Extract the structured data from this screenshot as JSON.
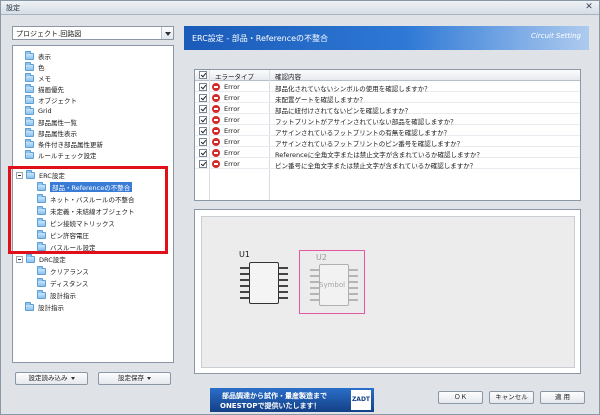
{
  "window": {
    "title": "設定",
    "close_glyph": "✕"
  },
  "project_combo": {
    "value": "プロジェクト.回路図"
  },
  "tree": {
    "items": [
      {
        "label": "表示",
        "level": 1
      },
      {
        "label": "色",
        "level": 1
      },
      {
        "label": "メモ",
        "level": 1
      },
      {
        "label": "描画優先",
        "level": 1
      },
      {
        "label": "オブジェクト",
        "level": 1
      },
      {
        "label": "Grid",
        "level": 1
      },
      {
        "label": "部品属性一覧",
        "level": 1
      },
      {
        "label": "部品属性表示",
        "level": 1
      },
      {
        "label": "条件付き部品属性更新",
        "level": 1
      },
      {
        "label": "ルールチェック設定",
        "level": 1
      },
      {
        "label": "ERC設定",
        "level": 0
      },
      {
        "label": "部品・Referenceの不整合",
        "level": 2,
        "selected": true
      },
      {
        "label": "ネット・バスルールの不整合",
        "level": 2
      },
      {
        "label": "未定義・未結線オブジェクト",
        "level": 2
      },
      {
        "label": "ピン接続マトリックス",
        "level": 2
      },
      {
        "label": "ピン許容電圧",
        "level": 2
      },
      {
        "label": "バスルール設定",
        "level": 2
      },
      {
        "label": "DRC設定",
        "level": 0
      },
      {
        "label": "クリアランス",
        "level": 2
      },
      {
        "label": "ディスタンス",
        "level": 2
      },
      {
        "label": "設計指示",
        "level": 2
      },
      {
        "label": "設計指示",
        "level": 1
      }
    ]
  },
  "buttons": {
    "load": "設定読み込み",
    "save": "設定保存",
    "ok": "ＯＫ",
    "cancel": "キャンセル",
    "apply": "適 用"
  },
  "header": {
    "title": "ERC設定 - 部品・Referenceの不整合",
    "brand": "Circuit Setting"
  },
  "table": {
    "columns": [
      "エラータイプ",
      "確認内容"
    ],
    "rows": [
      {
        "type": "Error",
        "desc": "部品化されていないシンボルの使用を確認しますか？"
      },
      {
        "type": "Error",
        "desc": "未配置ゲートを確認しますか？"
      },
      {
        "type": "Error",
        "desc": "部品に紐付けされてないピンを確認しますか？"
      },
      {
        "type": "Error",
        "desc": "フットプリントがアサインされていない部品を確認しますか？"
      },
      {
        "type": "Error",
        "desc": "アサインされているフットプリントの有無を確認しますか？"
      },
      {
        "type": "Error",
        "desc": "アサインされているフットプリントのピン番号を確認しますか？"
      },
      {
        "type": "Error",
        "desc": "Referenceに全角文字または禁止文字が含まれているか確認しますか？"
      },
      {
        "type": "Error",
        "desc": "ピン番号に全角文字または禁止文字が含まれているか確認しますか？"
      }
    ]
  },
  "preview": {
    "u1": "U1",
    "u2": "U2",
    "symbol": "Symbol"
  },
  "banner": {
    "line1": "部品調達から試作・量産製造まで",
    "line2": "ONESTOPで提供いたします！",
    "logo": "ZADT"
  },
  "colors": {
    "accent": "#2f79d6",
    "highlight": "#e0101a",
    "error": "#d32a2a"
  }
}
